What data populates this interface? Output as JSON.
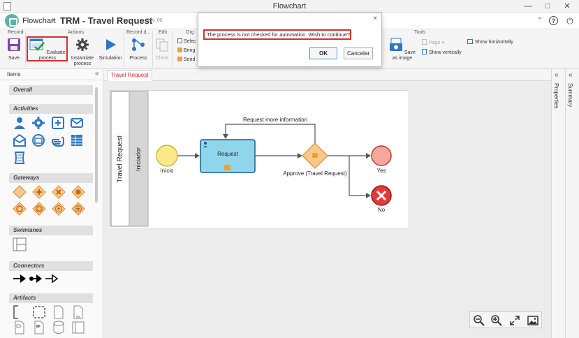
{
  "window": {
    "title": "Flowchart"
  },
  "header": {
    "breadcrumb": "Flowchart",
    "doc_title": "TRM - Travel Request",
    "revision": "Rev. 00"
  },
  "ribbon": {
    "groups": {
      "record": "Record",
      "actions": "Actions",
      "record_d": "Record d...",
      "edit": "Edit",
      "org": "Org",
      "tools": "Tools"
    },
    "buttons": {
      "save": "Save",
      "evaluate": "Evaluate process",
      "instantiate_1": "Instantiate",
      "instantiate_2": "process",
      "simulation": "Simulation",
      "process": "Process",
      "clone": "Clone",
      "select": "Selec",
      "bring": "Bring",
      "send": "Send",
      "page": "Page",
      "save_as_image": "Save as image",
      "show_horizontally": "Show horizontally",
      "show_vertically": "Show vertically"
    }
  },
  "left_panel": {
    "title": "Items",
    "sections": [
      "Overall",
      "Activities",
      "Gateways",
      "Swimlanes",
      "Connectors",
      "Artifacts"
    ]
  },
  "tabs": {
    "active": "Travel Request"
  },
  "diagram": {
    "pool": "Travel Request",
    "lane": "Iniciador",
    "start_event": "Início",
    "task": "Request",
    "loop_label": "Request more information",
    "gateway": "Approve (Travel Request)",
    "end_yes": "Yes",
    "end_no": "No"
  },
  "right_panels": {
    "properties": "Properties",
    "summary": "Summary"
  },
  "dialog": {
    "message": "The process is not checked for automation. Wish to continue?",
    "ok": "OK",
    "cancel": "Cancelar"
  },
  "colors": {
    "accent": "#c62828",
    "highlight": "#d32f2f",
    "task_fill": "#8fd6ec",
    "start_fill": "#fce98a",
    "gateway_fill": "#f8c98a",
    "end_yes_fill": "#f4a79d",
    "end_no_fill": "#e53935"
  }
}
